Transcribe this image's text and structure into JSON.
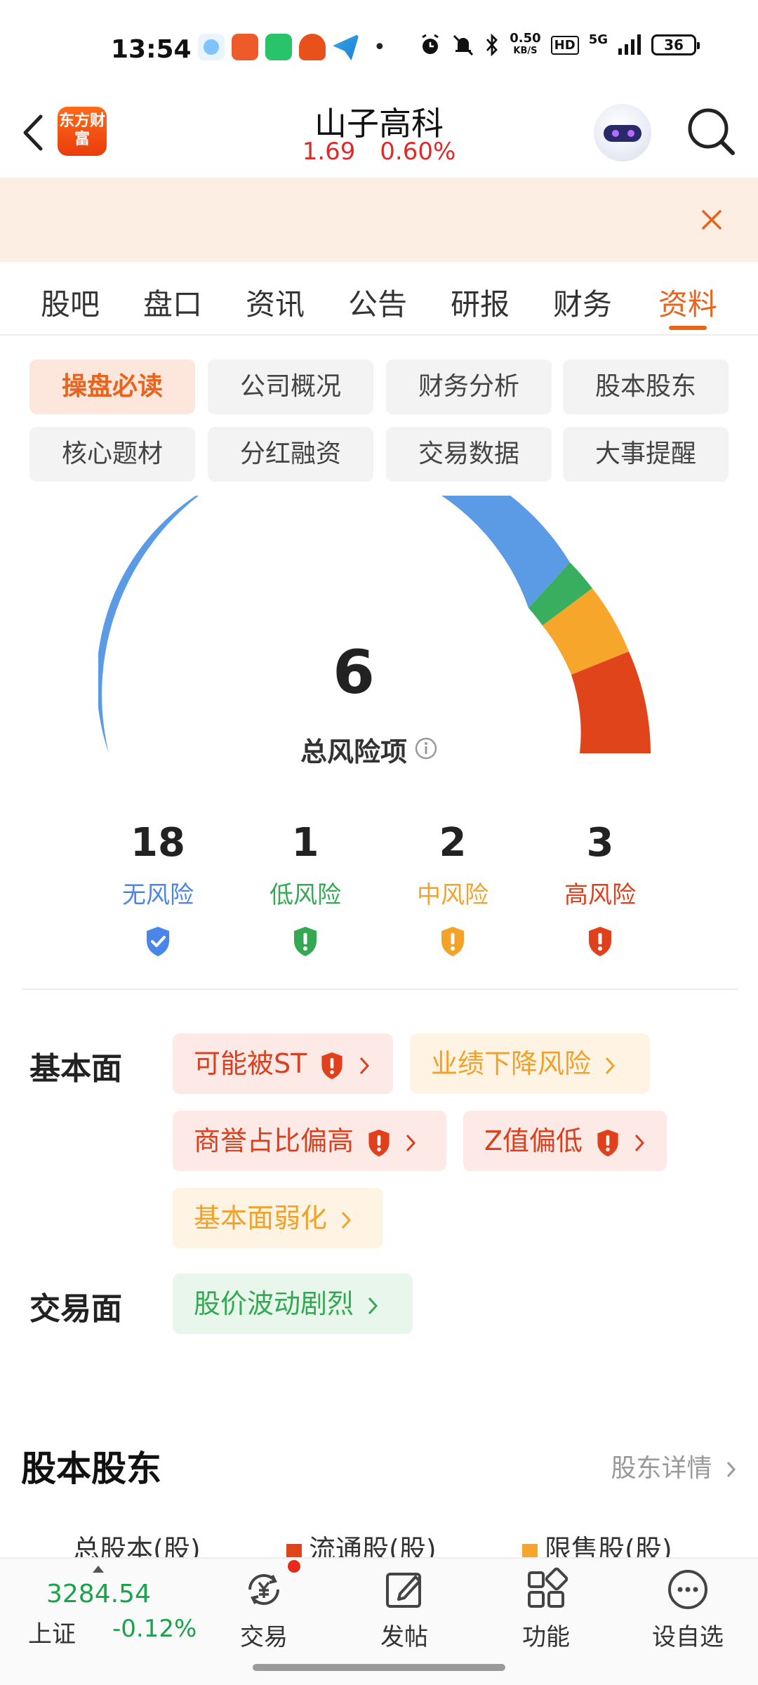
{
  "status_bar": {
    "time": "13:54",
    "dot": "•",
    "net_speed": "0.50",
    "net_unit": "KB/S",
    "hd": "HD",
    "signal": "5G",
    "battery": "36"
  },
  "header": {
    "logo_text": "东方财富",
    "stock_name": "山子高科",
    "price": "1.69",
    "change_pct": "0.60%",
    "price_color": "#e02929"
  },
  "tabs": [
    "股吧",
    "盘口",
    "资讯",
    "公告",
    "研报",
    "财务",
    "资料"
  ],
  "active_tab": "资料",
  "chips": [
    "操盘必读",
    "公司概况",
    "财务分析",
    "股本股东",
    "核心题材",
    "分红融资",
    "交易数据",
    "大事提醒"
  ],
  "active_chip": "操盘必读",
  "risk": {
    "total": "6",
    "total_label": "总风险项",
    "levels": [
      {
        "count": "18",
        "label": "无风险",
        "color": "#4a86e8",
        "shield_icon": "check-shield-icon"
      },
      {
        "count": "1",
        "label": "低风险",
        "color": "#34a853",
        "shield_icon": "exclamation-shield-icon"
      },
      {
        "count": "2",
        "label": "中风险",
        "color": "#f4a32a",
        "shield_icon": "exclamation-shield-icon"
      },
      {
        "count": "3",
        "label": "高风险",
        "color": "#e0401b",
        "shield_icon": "exclamation-shield-icon"
      }
    ]
  },
  "fundamentals": {
    "label": "基本面",
    "tags": [
      {
        "text": "可能被ST",
        "level": "high"
      },
      {
        "text": "业绩下降风险",
        "level": "medium"
      },
      {
        "text": "商誉占比偏高",
        "level": "high"
      },
      {
        "text": "Z值偏低",
        "level": "high"
      },
      {
        "text": "基本面弱化",
        "level": "medium"
      }
    ]
  },
  "trading": {
    "label": "交易面",
    "tags": [
      {
        "text": "股价波动剧烈",
        "level": "low"
      }
    ]
  },
  "equity": {
    "title": "股本股东",
    "link": "股东详情",
    "columns": [
      "总股本(股)",
      "流通股(股)",
      "限售股(股)"
    ]
  },
  "bottom_bar": {
    "index_value": "3284.54",
    "index_name": "上证",
    "index_change": "-0.12%",
    "items": [
      "交易",
      "发帖",
      "功能",
      "设自选"
    ]
  }
}
